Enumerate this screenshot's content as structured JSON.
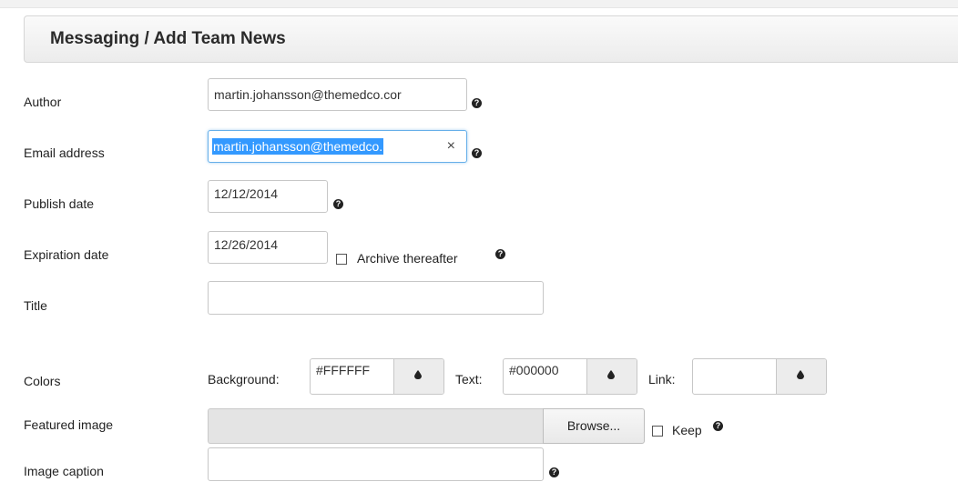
{
  "header": {
    "title": "Messaging / Add Team News"
  },
  "fields": {
    "author": {
      "label": "Author",
      "value": "martin.johansson@themedco.cor"
    },
    "email": {
      "label": "Email address",
      "value": "martin.johansson@themedco.",
      "clear_icon": "×"
    },
    "publish": {
      "label": "Publish date",
      "value": "12/12/2014"
    },
    "expiration": {
      "label": "Expiration date",
      "value": "12/26/2014",
      "archive_label": "Archive thereafter"
    },
    "title": {
      "label": "Title",
      "value": ""
    },
    "colors": {
      "label": "Colors",
      "background_label": "Background:",
      "background_value": "#FFFFFF",
      "text_label": "Text:",
      "text_value": "#000000",
      "link_label": "Link:",
      "link_value": "",
      "picker_icon": "color-drop-icon"
    },
    "featured": {
      "label": "Featured image",
      "browse_label": "Browse...",
      "keep_label": "Keep"
    },
    "caption": {
      "label": "Image caption",
      "value": ""
    }
  },
  "help_icon": "?"
}
